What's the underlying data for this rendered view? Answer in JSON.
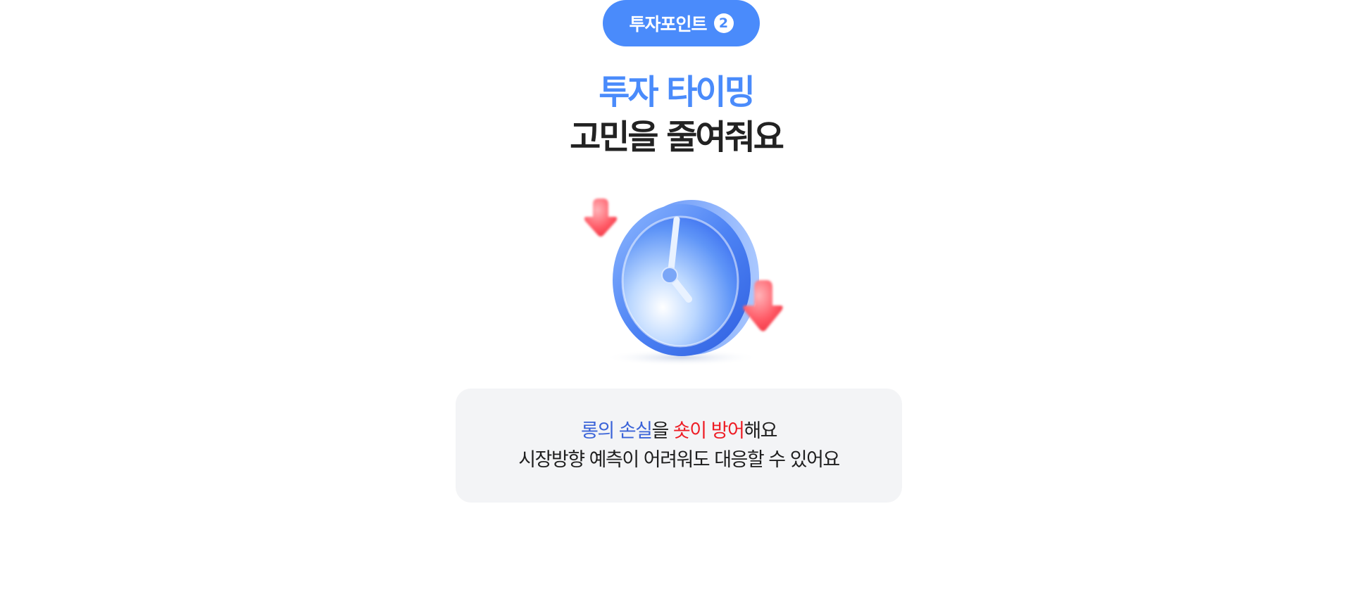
{
  "badge": {
    "label": "투자포인트",
    "number": "2"
  },
  "heading": {
    "line1": "투자 타이밍",
    "line2": "고민을 줄여줘요"
  },
  "illustration": {
    "icon": "clock-icon",
    "decorations": [
      "down-arrow-icon",
      "down-arrow-icon"
    ]
  },
  "info": {
    "line1": {
      "part_blue": "롱의 손실",
      "part_plain1": "을 ",
      "part_red": "숏이 방어",
      "part_plain2": "해요"
    },
    "line2": "시장방향 예측이 어려워도 대응할 수 있어요"
  },
  "colors": {
    "accent_blue": "#4a8bfb",
    "text_blue": "#3a63d8",
    "text_red": "#ee1c24",
    "box_bg": "#f3f4f6"
  }
}
